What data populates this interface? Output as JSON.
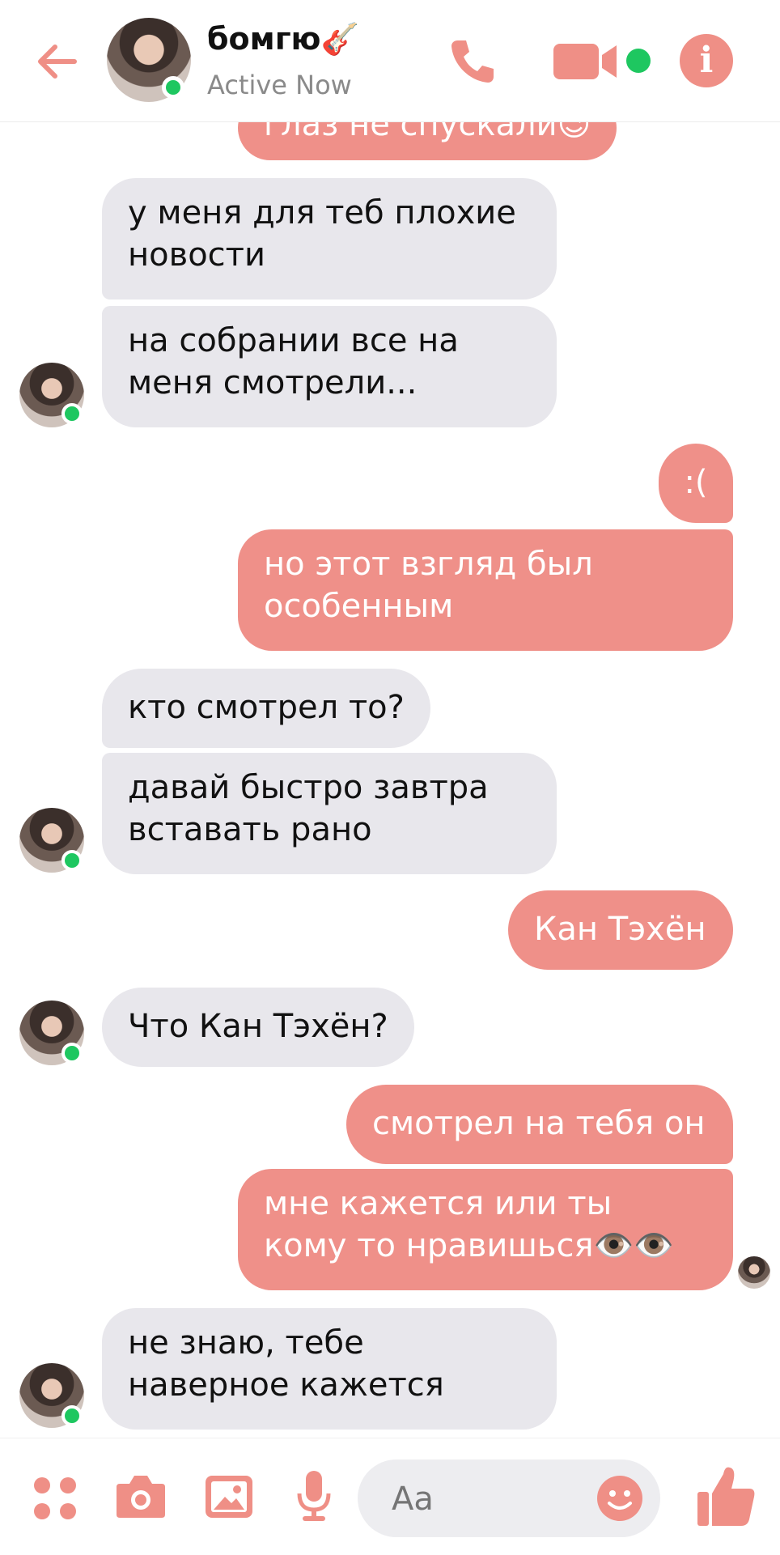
{
  "header": {
    "contact_name": "бомгю🎸",
    "status": "Active Now",
    "info_glyph": "i"
  },
  "colors": {
    "accent": "#ef8f86",
    "incoming_bubble": "#e8e7ec",
    "outgoing_bubble": "#ef9089",
    "online": "#1ec760"
  },
  "messages": [
    {
      "from": "me",
      "text": "глаз не спускали😉"
    },
    {
      "from": "them",
      "text": "у меня для теб плохие\nновости"
    },
    {
      "from": "them",
      "text": "на собрании все на\nменя смотрели..."
    },
    {
      "from": "me",
      "text": ":("
    },
    {
      "from": "me",
      "text": "но этот взгляд был\nособенным"
    },
    {
      "from": "them",
      "text": "кто смотрел то?"
    },
    {
      "from": "them",
      "text": "давай быстро завтра\nвставать рано"
    },
    {
      "from": "me",
      "text": "Кан Тэхён"
    },
    {
      "from": "them",
      "text": "Что Кан Тэхён?"
    },
    {
      "from": "me",
      "text": "смотрел на тебя он"
    },
    {
      "from": "me",
      "text": "мне кажется  или ты\nкому то нравишься👁️👁️"
    },
    {
      "from": "them",
      "text": "не знаю, тебе\nнаверное кажется"
    }
  ],
  "composer": {
    "placeholder": "Aa"
  },
  "footer_icons": [
    "apps-icon",
    "camera-icon",
    "image-icon",
    "microphone-icon",
    "emoji-icon",
    "thumbs-up-icon"
  ]
}
